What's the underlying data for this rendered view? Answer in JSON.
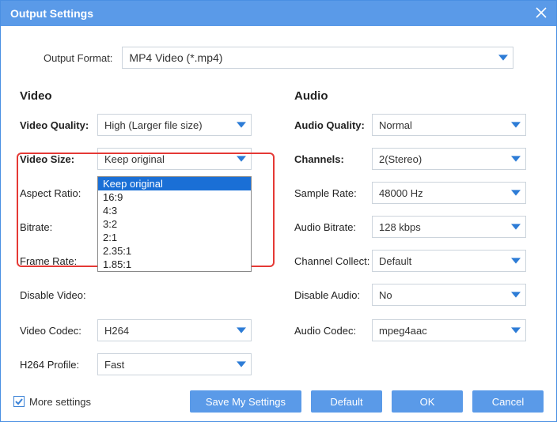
{
  "window": {
    "title": "Output Settings"
  },
  "output_format": {
    "label": "Output Format:",
    "value": "MP4 Video (*.mp4)"
  },
  "video": {
    "title": "Video",
    "quality": {
      "label": "Video Quality:",
      "value": "High (Larger file size)"
    },
    "size": {
      "label": "Video Size:",
      "value": "Keep original"
    },
    "aspect": {
      "label": "Aspect Ratio:",
      "value": "Keep original",
      "options": [
        "Keep original",
        "16:9",
        "4:3",
        "3:2",
        "2:1",
        "2.35:1",
        "1.85:1"
      ]
    },
    "bitrate": {
      "label": "Bitrate:"
    },
    "framerate": {
      "label": "Frame Rate:"
    },
    "disable": {
      "label": "Disable Video:"
    },
    "codec": {
      "label": "Video Codec:",
      "value": "H264"
    },
    "profile": {
      "label": "H264 Profile:",
      "value": "Fast"
    }
  },
  "audio": {
    "title": "Audio",
    "quality": {
      "label": "Audio Quality:",
      "value": "Normal"
    },
    "channels": {
      "label": "Channels:",
      "value": "2(Stereo)"
    },
    "sample": {
      "label": "Sample Rate:",
      "value": "48000 Hz"
    },
    "bitrate": {
      "label": "Audio Bitrate:",
      "value": "128 kbps"
    },
    "collect": {
      "label": "Channel Collect:",
      "value": "Default"
    },
    "disable": {
      "label": "Disable Audio:",
      "value": "No"
    },
    "codec": {
      "label": "Audio Codec:",
      "value": "mpeg4aac"
    }
  },
  "footer": {
    "more_settings": "More settings",
    "save": "Save My Settings",
    "default": "Default",
    "ok": "OK",
    "cancel": "Cancel"
  }
}
